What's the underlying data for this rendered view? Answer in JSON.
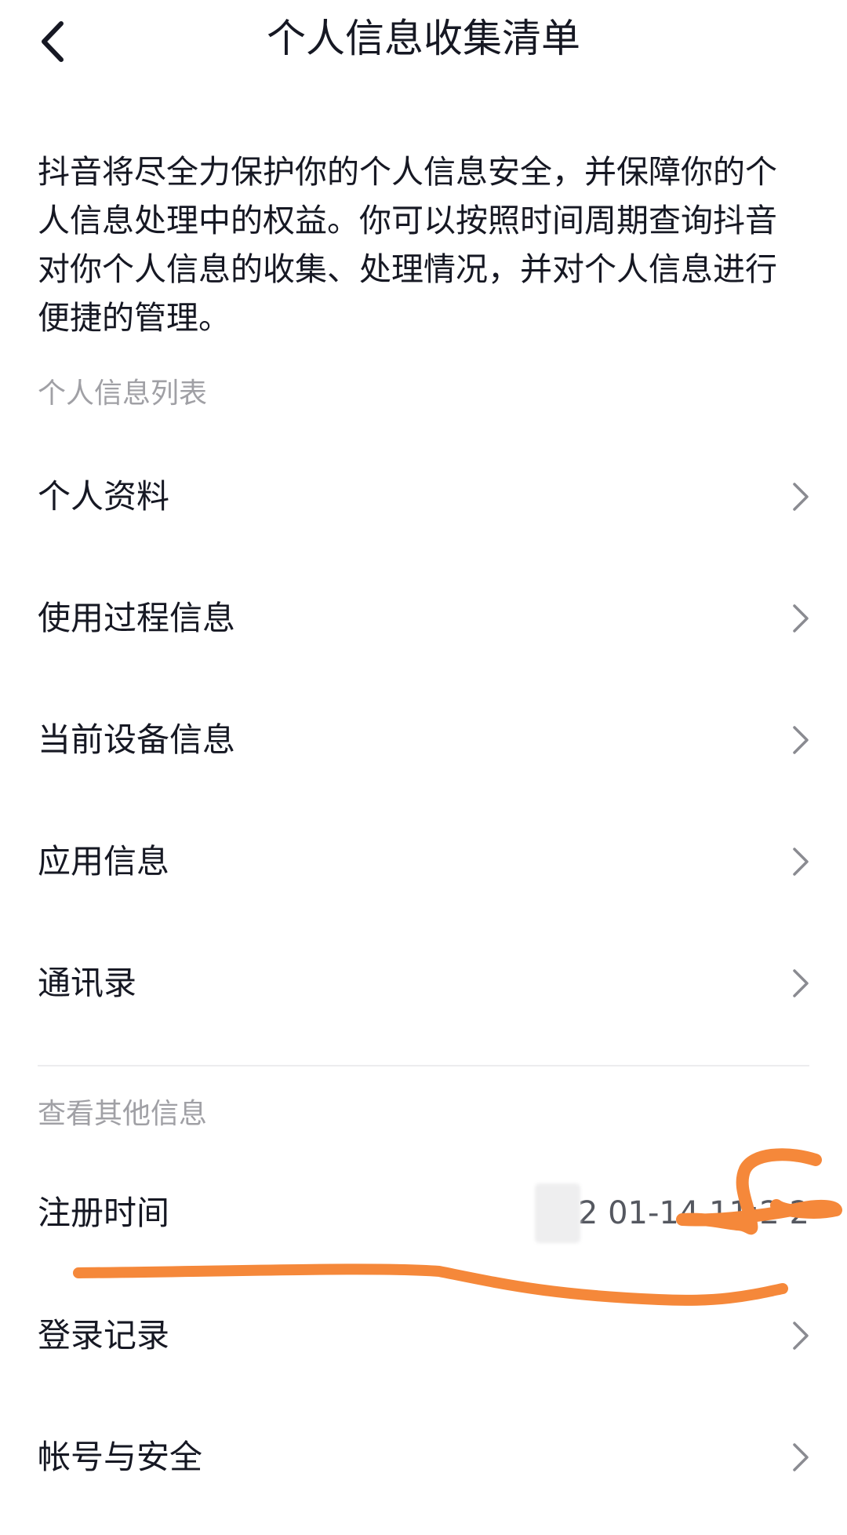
{
  "header": {
    "title": "个人信息收集清单",
    "back_icon": "chevron-left-icon"
  },
  "intro": {
    "text": "抖音将尽全力保护你的个人信息安全，并保障你的个人信息处理中的权益。你可以按照时间周期查询抖音对你个人信息的收集、处理情况，并对个人信息进行便捷的管理。"
  },
  "sections": {
    "personal_list_label": "个人信息列表",
    "other_info_label": "查看其他信息"
  },
  "personal_items": [
    {
      "label": "个人资料",
      "icon": "chevron-right-icon"
    },
    {
      "label": "使用过程信息",
      "icon": "chevron-right-icon"
    },
    {
      "label": "当前设备信息",
      "icon": "chevron-right-icon"
    },
    {
      "label": "应用信息",
      "icon": "chevron-right-icon"
    },
    {
      "label": "通讯录",
      "icon": "chevron-right-icon"
    }
  ],
  "registration": {
    "label": "注册时间",
    "value": "202  01-14 11:2  2"
  },
  "other_items": [
    {
      "label": "登录记录",
      "icon": "chevron-right-icon"
    },
    {
      "label": "帐号与安全",
      "icon": "chevron-right-icon"
    }
  ],
  "colors": {
    "text_primary": "#161823",
    "text_secondary": "#a0a0a5",
    "annotation": "#f5883a"
  }
}
